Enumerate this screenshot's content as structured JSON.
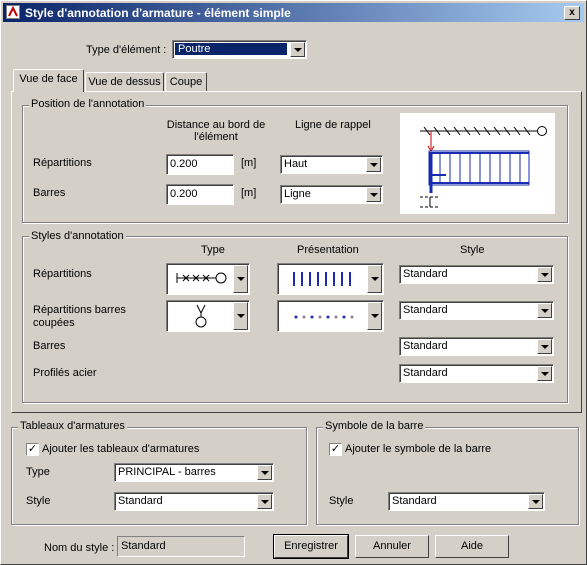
{
  "window": {
    "title": "Style d'annotation d'armature - élément simple",
    "close": "x"
  },
  "element_type": {
    "label": "Type d'élément :",
    "value": "Poutre"
  },
  "tabs": [
    {
      "label": "Vue de face"
    },
    {
      "label": "Vue de dessus"
    },
    {
      "label": "Coupe"
    }
  ],
  "position": {
    "title": "Position de l'annotation",
    "col_distance": "Distance au bord de l'élément",
    "col_rappel": "Ligne de rappel",
    "rows": [
      {
        "label": "Répartitions",
        "distance": "0.200",
        "unit": "[m]",
        "rappel": "Haut"
      },
      {
        "label": "Barres",
        "distance": "0.200",
        "unit": "[m]",
        "rappel": "Ligne"
      }
    ]
  },
  "styles": {
    "title": "Styles d'annotation",
    "col_type": "Type",
    "col_presentation": "Présentation",
    "col_style": "Style",
    "rows": [
      {
        "label": "Répartitions",
        "style": "Standard"
      },
      {
        "label": "Répartitions barres\ncoupées",
        "style": "Standard"
      },
      {
        "label": "Barres",
        "style": "Standard"
      },
      {
        "label": "Profilés acier",
        "style": "Standard"
      }
    ]
  },
  "tableaux": {
    "title": "Tableaux d'armatures",
    "checkbox_label": "Ajouter les tableaux d'armatures",
    "checked": true,
    "type_label": "Type",
    "type_value": "PRINCIPAL - barres",
    "style_label": "Style",
    "style_value": "Standard"
  },
  "symbole": {
    "title": "Symbole de la barre",
    "checkbox_label": "Ajouter le symbole de la barre",
    "checked": true,
    "style_label": "Style",
    "style_value": "Standard"
  },
  "footer": {
    "style_name_label": "Nom du style :",
    "style_name_value": "Standard",
    "buttons": {
      "save": "Enregistrer",
      "cancel": "Annuler",
      "help": "Aide"
    }
  },
  "colors": {
    "titlebar": "#0a246a",
    "accent_blue": "#1a2bb0",
    "accent_red": "#cc0000"
  }
}
